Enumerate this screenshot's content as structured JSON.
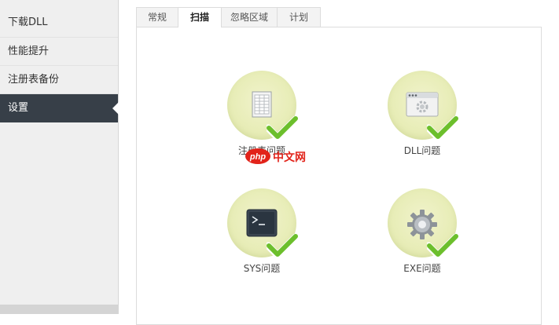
{
  "sidebar": {
    "items": [
      {
        "label": "下载DLL"
      },
      {
        "label": "性能提升"
      },
      {
        "label": "注册表备份"
      },
      {
        "label": "设置"
      }
    ],
    "active_index": 3
  },
  "tabs": [
    {
      "label": "常规"
    },
    {
      "label": "扫描"
    },
    {
      "label": "忽略区域"
    },
    {
      "label": "计划"
    }
  ],
  "active_tab": 1,
  "scan_items": [
    {
      "label": "注册表问题",
      "icon": "registry-document-icon",
      "checked": true
    },
    {
      "label": "DLL问题",
      "icon": "window-gear-icon",
      "checked": true
    },
    {
      "label": "SYS问题",
      "icon": "terminal-icon",
      "checked": true
    },
    {
      "label": "EXE问题",
      "icon": "gear-icon",
      "checked": true
    }
  ],
  "watermark": {
    "text": "php中文网",
    "logo_text": "php",
    "cn_text": "中文网"
  },
  "colors": {
    "sidebar_active": "#373f48",
    "check_green": "#6cbf2c",
    "circle_bg": "#e8edb8",
    "watermark_red": "#e2231a"
  }
}
